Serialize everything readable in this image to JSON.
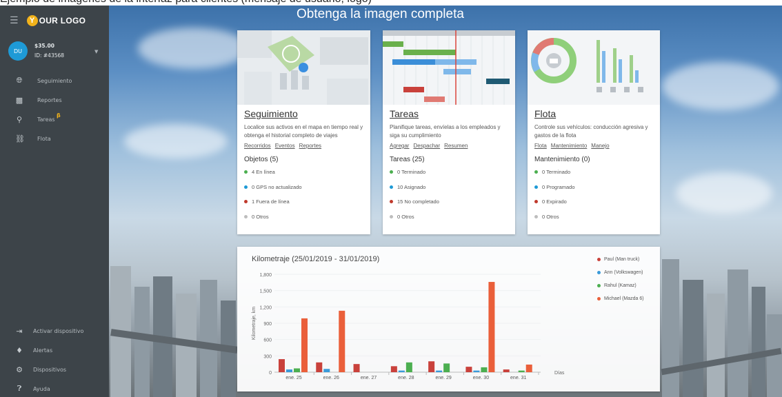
{
  "colors": {
    "sidebar": "#3d4449",
    "accent_blue": "#1e9ad6",
    "green": "#4caf50",
    "red": "#c0392b",
    "grey": "#bdbdbd",
    "orange": "#ea5f3a",
    "logo_yellow": "#f2b31b"
  },
  "top_strip": {
    "text": "Ejemplo de imágenes de la interfaz para clientes (mensaje de usuario, logo)"
  },
  "header": {
    "logo_badge": "Y",
    "logo_text": "OUR LOGO",
    "menu_icon": "hamburger-icon"
  },
  "user": {
    "initials": "DU",
    "balance": "$35.00",
    "id": "ID: #43568"
  },
  "sidebar": {
    "items": [
      {
        "icon": "globe-icon",
        "label": "Seguimiento"
      },
      {
        "icon": "report-icon",
        "label": "Reportes"
      },
      {
        "icon": "pin-icon",
        "label": "Tareas",
        "badge": "β"
      },
      {
        "icon": "car-icon",
        "label": "Flota"
      }
    ],
    "bottom_items": [
      {
        "icon": "login-icon",
        "label": "Activar dispositivo"
      },
      {
        "icon": "bell-icon",
        "label": "Alertas"
      },
      {
        "icon": "gear-icon",
        "label": "Dispositivos"
      },
      {
        "icon": "help-icon",
        "label": "Ayuda"
      }
    ]
  },
  "hero": {
    "title": "Obtenga la imagen completa"
  },
  "cards": [
    {
      "title": "Seguimiento",
      "description": "Localice sus activos en el mapa en tiempo real y obtenga el historial completo de viajes",
      "links": [
        "Recorridos",
        "Eventos",
        "Reportes"
      ],
      "subtitle": "Objetos (5)",
      "stats": [
        {
          "color": "#4caf50",
          "text": "4 En línea"
        },
        {
          "color": "#1e9ad6",
          "text": "0 GPS no actualizado"
        },
        {
          "color": "#c0392b",
          "text": "1 Fuera de línea"
        },
        {
          "color": "#bdbdbd",
          "text": "0 Otros"
        }
      ]
    },
    {
      "title": "Tareas",
      "description": "Planifique tareas, envíelas a los empleados y siga su cumplimiento",
      "links": [
        "Agregar",
        "Despachar",
        "Resumen"
      ],
      "subtitle": "Tareas (25)",
      "stats": [
        {
          "color": "#4caf50",
          "text": "0 Terminado"
        },
        {
          "color": "#1e9ad6",
          "text": "10 Asignado"
        },
        {
          "color": "#c0392b",
          "text": "15 No completado"
        },
        {
          "color": "#bdbdbd",
          "text": "0 Otros"
        }
      ]
    },
    {
      "title": "Flota",
      "description": "Controle sus vehículos: conducción agresiva y gastos de la flota",
      "links": [
        "Flota",
        "Mantenimiento",
        "Manejo"
      ],
      "subtitle": "Mantenimiento (0)",
      "stats": [
        {
          "color": "#4caf50",
          "text": "0 Terminado"
        },
        {
          "color": "#1e9ad6",
          "text": "0 Programado"
        },
        {
          "color": "#c0392b",
          "text": "0 Expirado"
        },
        {
          "color": "#bdbdbd",
          "text": "0 Otros"
        }
      ]
    }
  ],
  "chart_data": {
    "type": "bar",
    "title": "Kilometraje (25/01/2019 - 31/01/2019)",
    "ylabel": "Kilometraje, km",
    "xlabel": "Días",
    "ylim": [
      0,
      1800
    ],
    "yticks": [
      0,
      300,
      600,
      900,
      1200,
      1500,
      1800
    ],
    "legend_position": "top-right",
    "categories": [
      "ene. 25",
      "ene. 26",
      "ene. 27",
      "ene. 28",
      "ene. 29",
      "ene. 30",
      "ene. 31"
    ],
    "series": [
      {
        "name": "Paul (Man truck)",
        "color": "#c9413b",
        "values": [
          240,
          180,
          150,
          110,
          200,
          100,
          50
        ]
      },
      {
        "name": "Ann (Volkswagen)",
        "color": "#3a9ad9",
        "values": [
          50,
          60,
          0,
          30,
          30,
          30,
          0
        ]
      },
      {
        "name": "Rahul (Kamaz)",
        "color": "#4caf50",
        "values": [
          70,
          0,
          0,
          180,
          160,
          90,
          30
        ]
      },
      {
        "name": "Michael (Mazda 6)",
        "color": "#ea5f3a",
        "values": [
          990,
          1130,
          0,
          0,
          0,
          1660,
          140
        ]
      }
    ]
  }
}
